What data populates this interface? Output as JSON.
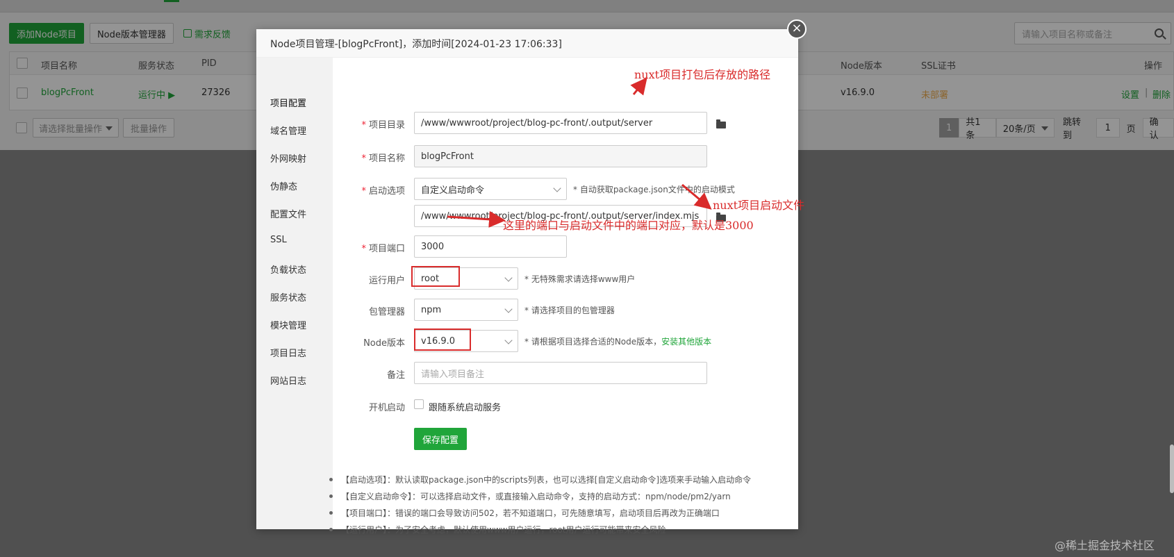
{
  "toolbar": {
    "add_node": "添加Node项目",
    "version_manager": "Node版本管理器",
    "feedback": "需求反馈",
    "search_placeholder": "请输入项目名称或备注"
  },
  "table": {
    "headers": [
      "项目名称",
      "服务状态",
      "PID",
      "Node版本",
      "SSL证书",
      "操作"
    ],
    "row": {
      "name": "blogPcFront",
      "status": "运行中 ▶",
      "pid": "27326",
      "node_version": "v16.9.0",
      "ssl": "未部署",
      "action_settings": "设置",
      "action_sep": "|",
      "action_delete": "删除"
    }
  },
  "footer": {
    "batch_select": "请选择批量操作",
    "batch_button": "批量操作",
    "page_current": "1",
    "total": "共1条",
    "per_page": "20条/页",
    "jump_to": "跳转到",
    "jump_value": "1",
    "page_unit": "页",
    "confirm": "确认"
  },
  "modal": {
    "title": "Node项目管理-[blogPcFront]，添加时间[2024-01-23 17:06:33]",
    "close": "×",
    "sidebar": [
      "项目配置",
      "域名管理",
      "外网映射",
      "伪静态",
      "配置文件",
      "SSL",
      "负载状态",
      "服务状态",
      "模块管理",
      "项目日志",
      "网站日志"
    ],
    "form": {
      "dir_label": "项目目录",
      "dir_value": "/www/wwwroot/project/blog-pc-front/.output/server",
      "name_label": "项目名称",
      "name_value": "blogPcFront",
      "start_label": "启动选项",
      "start_value": "自定义启动命令",
      "start_hint": "* 自动获取package.json文件中的启动模式",
      "start_file": "/www/wwwroot/project/blog-pc-front/.output/server/index.mjs",
      "port_label": "项目端口",
      "port_value": "3000",
      "user_label": "运行用户",
      "user_value": "root",
      "user_hint": "* 无特殊需求请选择www用户",
      "pm_label": "包管理器",
      "pm_value": "npm",
      "pm_hint": "* 请选择项目的包管理器",
      "node_label": "Node版本",
      "node_value": "v16.9.0",
      "node_hint": "* 请根据项目选择合适的Node版本，",
      "node_hint_link": "安装其他版本",
      "remark_label": "备注",
      "remark_placeholder": "请输入项目备注",
      "boot_label": "开机启动",
      "boot_checkbox": "跟随系统启动服务",
      "save": "保存配置"
    },
    "notes": [
      "【启动选项】：默认读取package.json中的scripts列表，也可以选择[自定义启动命令]选项来手动输入启动命令",
      "【自定义启动命令】：可以选择启动文件，或直接输入启动命令，支持的启动方式：npm/node/pm2/yarn",
      "【项目端口】：错误的端口会导致访问502，若不知道端口，可先随意填写，启动项目后再改为正确端口",
      "【运行用户】：为了安全考虑，默认使用www用户运行，root用户运行可能带来安全风险"
    ]
  },
  "annotations": {
    "path_note": "nuxt项目打包后存放的路径",
    "start_file_note": "nuxt项目启动文件",
    "port_note": "这里的端口与启动文件中的端口对应，默认是3000",
    "color": "#d92b2b"
  },
  "watermark": "@稀土掘金技术社区",
  "colors": {
    "accent": "#20a53a",
    "warning": "#f0ad4e"
  }
}
